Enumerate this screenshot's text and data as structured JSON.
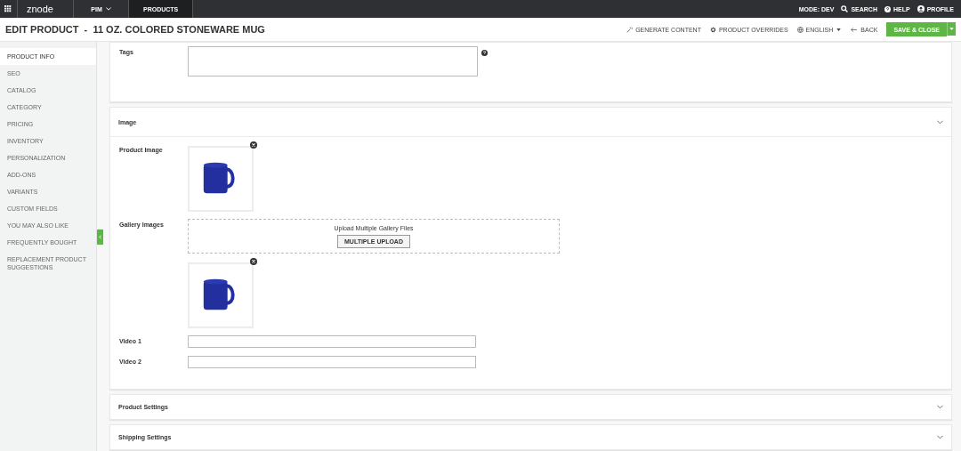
{
  "topbar": {
    "logo": "znode",
    "menus": [
      {
        "label": "PIM",
        "selected": false,
        "dropdown": true
      },
      {
        "label": "PRODUCTS",
        "selected": true,
        "dropdown": false
      }
    ],
    "right": [
      {
        "kind": "text",
        "label": "MODE: DEV"
      },
      {
        "kind": "search",
        "label": "SEARCH"
      },
      {
        "kind": "help",
        "label": "HELP"
      },
      {
        "kind": "profile",
        "label": "PROFILE"
      }
    ]
  },
  "header": {
    "title": "EDIT PRODUCT  -  11 OZ. COLORED STONEWARE MUG",
    "actions": [
      {
        "kind": "wand",
        "label": "GENERATE CONTENT"
      },
      {
        "kind": "gear",
        "label": "PRODUCT OVERRIDES"
      },
      {
        "kind": "globe",
        "label": "ENGLISH"
      },
      {
        "kind": "back",
        "label": "BACK"
      }
    ],
    "save": "SAVE & CLOSE"
  },
  "sidebar": {
    "items": [
      {
        "label": "PRODUCT INFO",
        "selected": true
      },
      {
        "label": "SEO",
        "selected": false
      },
      {
        "label": "CATALOG",
        "selected": false
      },
      {
        "label": "CATEGORY",
        "selected": false
      },
      {
        "label": "PRICING",
        "selected": false
      },
      {
        "label": "INVENTORY",
        "selected": false
      },
      {
        "label": "PERSONALIZATION",
        "selected": false
      },
      {
        "label": "ADD-ONS",
        "selected": false
      },
      {
        "label": "VARIANTS",
        "selected": false
      },
      {
        "label": "CUSTOM FIELDS",
        "selected": false
      },
      {
        "label": "YOU MAY ALSO LIKE",
        "selected": false
      },
      {
        "label": "FREQUENTLY BOUGHT",
        "selected": false
      },
      {
        "label": "REPLACEMENT PRODUCT SUGGESTIONS",
        "selected": false
      }
    ]
  },
  "sections": [
    {
      "fields": [
        {
          "kind": "textarea",
          "label": "Tags",
          "help": true
        }
      ]
    },
    {
      "title": "Image",
      "expanded": true,
      "fields": [
        {
          "kind": "image",
          "label": "Product Image"
        },
        {
          "kind": "upload",
          "label": "Gallery Images",
          "text": "Upload Multiple Gallery Files",
          "button": "MULTIPLE UPLOAD"
        },
        {
          "kind": "image"
        },
        {
          "kind": "text",
          "label": "Video 1"
        },
        {
          "kind": "text",
          "label": "Video 2"
        }
      ]
    },
    {
      "title": "Product Settings",
      "expanded": false
    },
    {
      "title": "Shipping Settings",
      "expanded": false
    }
  ]
}
